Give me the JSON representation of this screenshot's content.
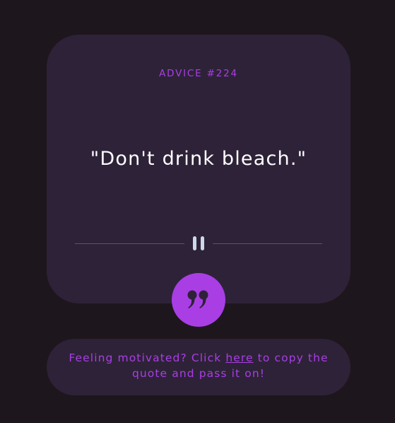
{
  "card": {
    "advice_label": "ADVICE #224",
    "quote": "\"Don't drink bleach.\""
  },
  "divider": {
    "icon": "pause-icon"
  },
  "dice_button": {
    "icon": "quote-mark-icon"
  },
  "footer": {
    "text_before": "Feeling motivated? Click ",
    "link_text": "here",
    "text_after": " to copy the quote and pass it on!"
  },
  "colors": {
    "background": "#1e161d",
    "card": "#2e2238",
    "accent": "#a93ee5",
    "text": "#ffffff",
    "divider_line": "#4f5871",
    "pause_icon": "#cdd8ea"
  }
}
